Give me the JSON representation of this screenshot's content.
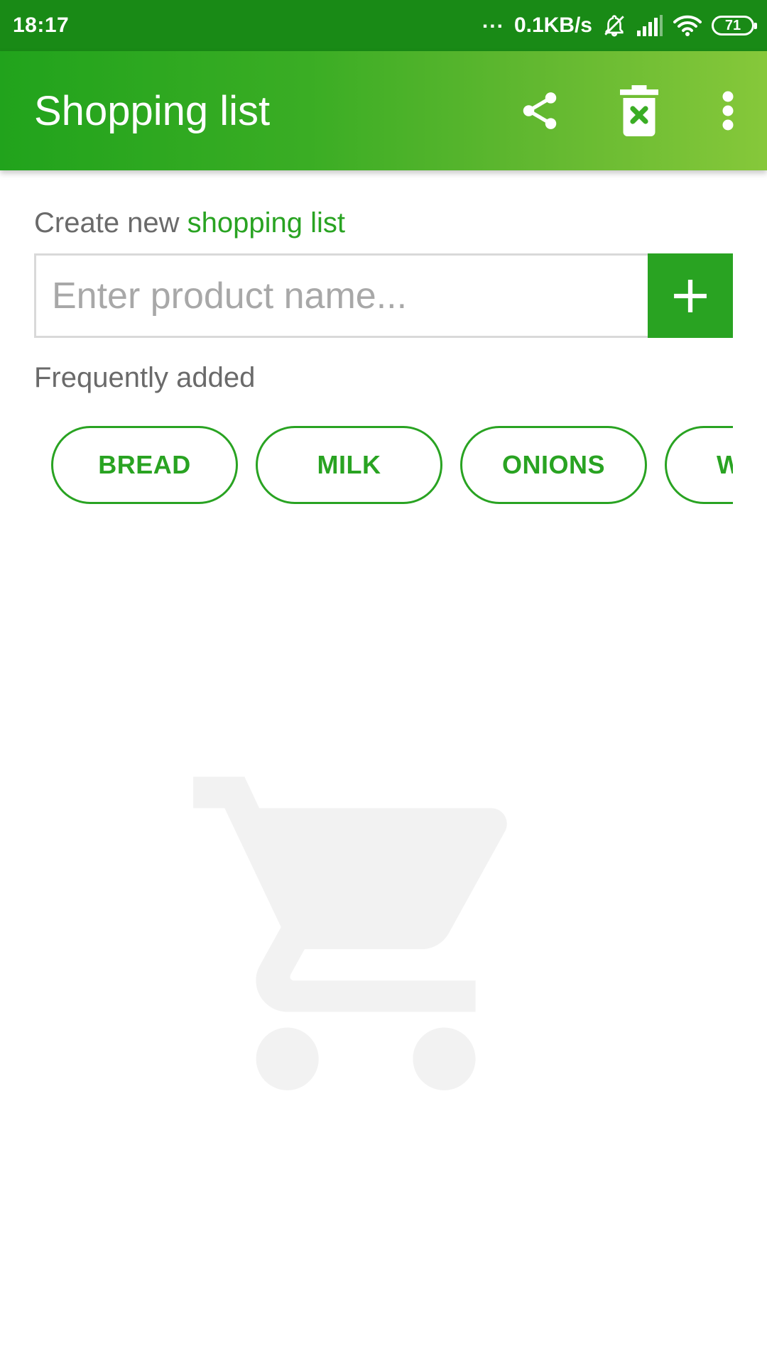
{
  "status_bar": {
    "time": "18:17",
    "dots": "...",
    "network_speed": "0.1KB/s",
    "battery": "71",
    "icons": [
      "bell-muted-icon",
      "signal-icon",
      "wifi-icon",
      "battery-icon"
    ]
  },
  "app_bar": {
    "title": "Shopping list",
    "actions": [
      "share-icon",
      "delete-list-icon",
      "more-vert-icon"
    ]
  },
  "create_section": {
    "label_prefix": "Create new ",
    "label_accent": "shopping list",
    "input_value": "",
    "input_placeholder": "Enter product name...",
    "add_icon": "plus-icon"
  },
  "frequent": {
    "label": "Frequently added",
    "items": [
      "BREAD",
      "MILK",
      "ONIONS",
      "W"
    ]
  },
  "empty_state": {
    "icon": "shopping-cart-icon"
  },
  "colors": {
    "status_bar": "#198a16",
    "accent": "#29a322",
    "app_bar_start": "#21a31c",
    "app_bar_end": "#86c83a",
    "muted_text": "#6a6a6a",
    "placeholder": "#a8a8a8",
    "empty_icon": "#f2f2f2"
  }
}
